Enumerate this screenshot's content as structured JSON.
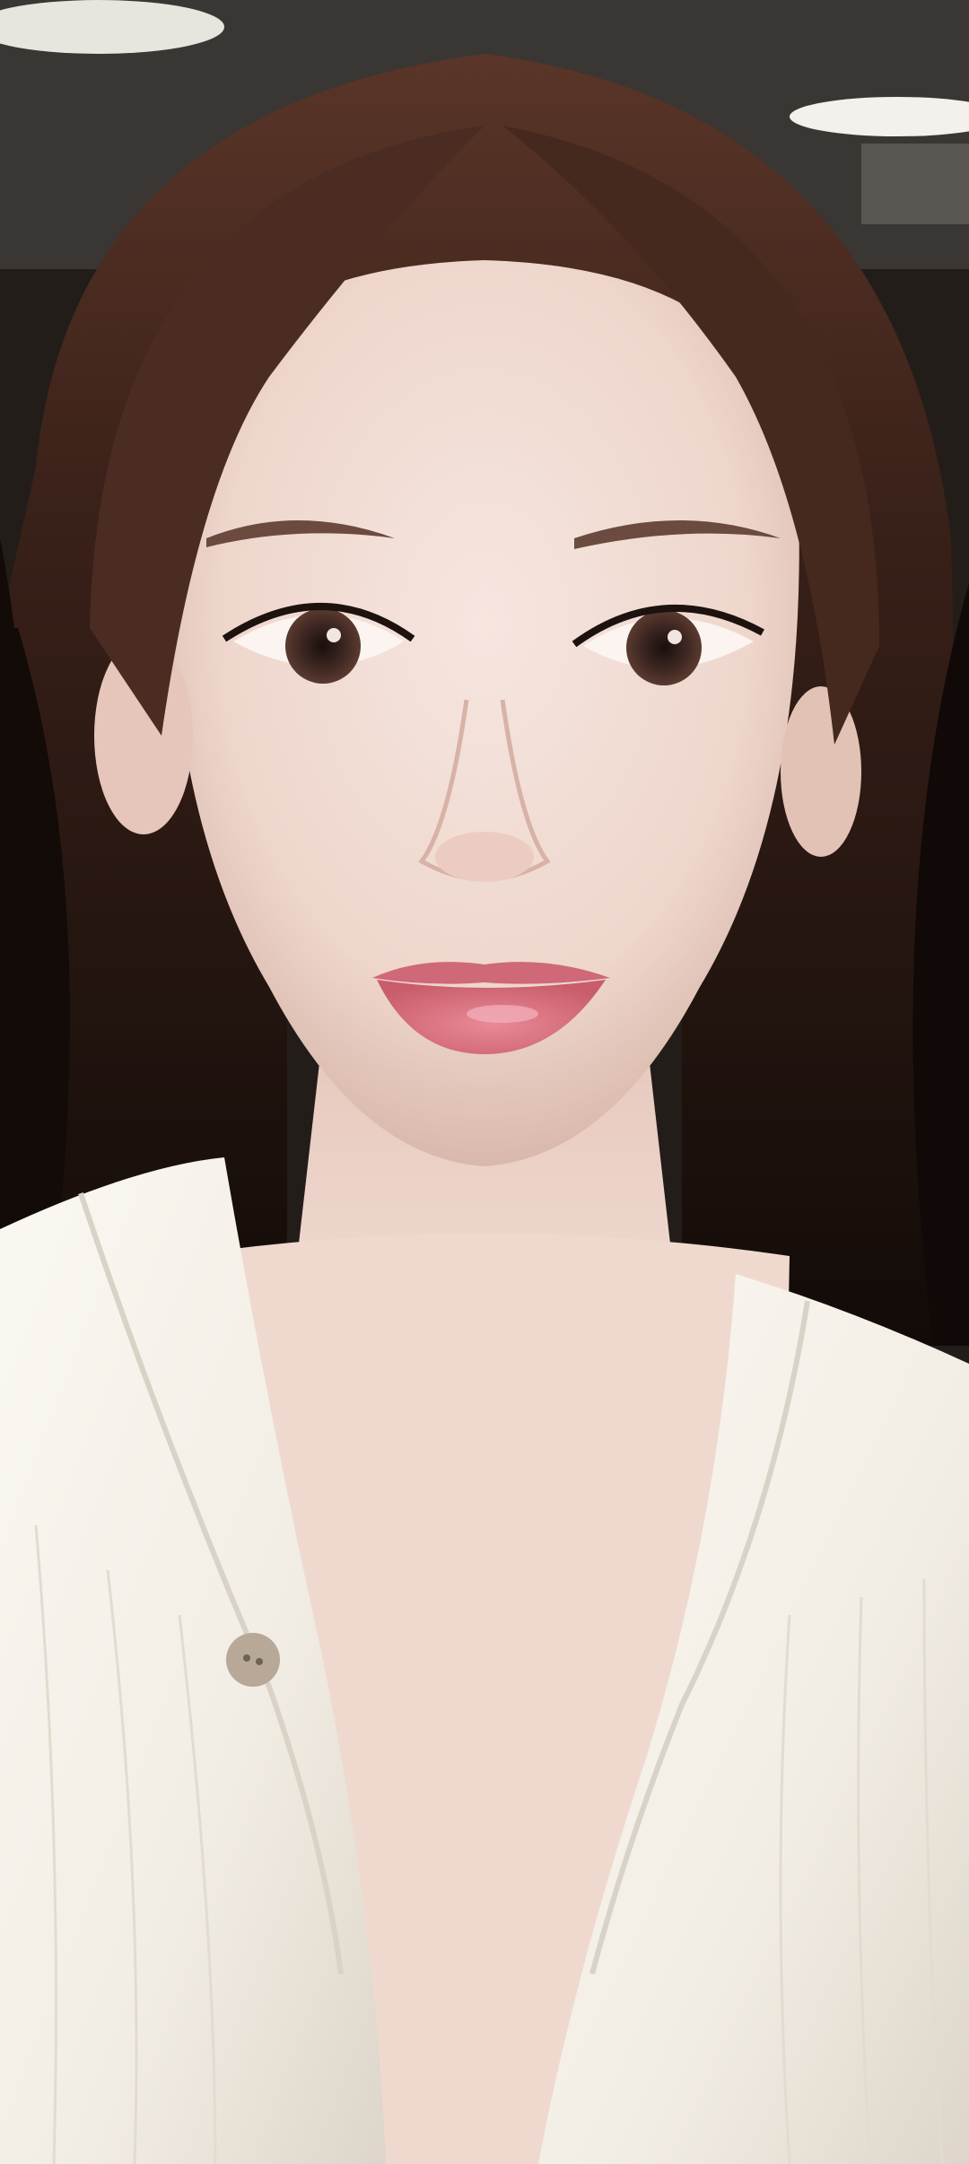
{
  "photo": {
    "subject": "portrait-selfie",
    "colors": {
      "background_top": "#3a3633",
      "ceiling_light": "#f4f1ec",
      "hair_dark": "#140d0a",
      "hair_brown": "#4a2c22",
      "skin": "#f0dcd4",
      "skin_shadow": "#dcbfb5",
      "lips": "#d96f7c",
      "iris": "#3b2520",
      "blouse": "#f7f4ee",
      "blouse_shadow": "#d9d2c6",
      "button": "#b8a898"
    }
  }
}
